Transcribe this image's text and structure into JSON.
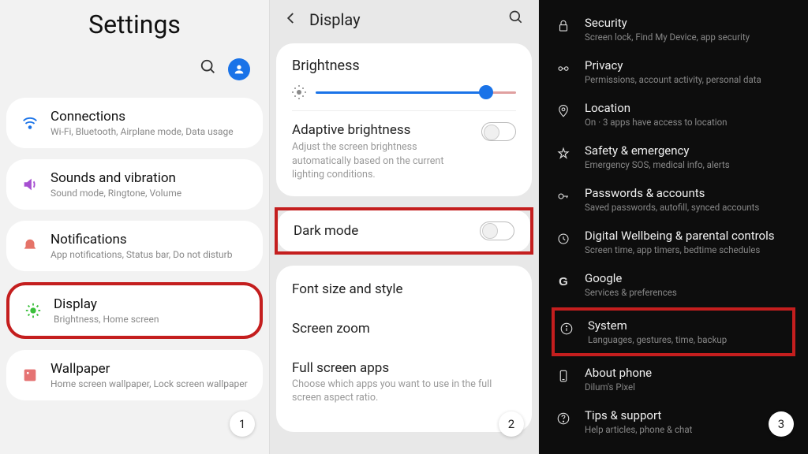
{
  "badges": {
    "one": "1",
    "two": "2",
    "three": "3"
  },
  "screen1": {
    "title": "Settings",
    "items": [
      {
        "icon": "wifi",
        "color": "#1a73e8",
        "title": "Connections",
        "desc": "Wi-Fi, Bluetooth, Airplane mode, Data usage"
      },
      {
        "icon": "sound",
        "color": "#a64fd1",
        "title": "Sounds and vibration",
        "desc": "Sound mode, Ringtone, Volume"
      },
      {
        "icon": "bell",
        "color": "#e57368",
        "title": "Notifications",
        "desc": "App notifications, Status bar, Do not disturb"
      },
      {
        "icon": "brightness",
        "color": "#3bbf3b",
        "title": "Display",
        "desc": "Brightness, Home screen",
        "highlight": true
      },
      {
        "icon": "wallpaper",
        "color": "#e57373",
        "title": "Wallpaper",
        "desc": "Home screen wallpaper, Lock screen wallpaper"
      }
    ]
  },
  "screen2": {
    "title": "Display",
    "brightness_header": "Brightness",
    "adaptive": {
      "title": "Adaptive brightness",
      "desc": "Adjust the screen brightness automatically based on the current lighting conditions."
    },
    "darkmode": "Dark mode",
    "list": [
      {
        "title": "Font size and style",
        "desc": ""
      },
      {
        "title": "Screen zoom",
        "desc": ""
      },
      {
        "title": "Full screen apps",
        "desc": "Choose which apps you want to use in the full screen aspect ratio."
      }
    ]
  },
  "screen3": {
    "items": [
      {
        "icon": "lock",
        "title": "Security",
        "desc": "Screen lock, Find My Device, app security"
      },
      {
        "icon": "privacy",
        "title": "Privacy",
        "desc": "Permissions, account activity, personal data"
      },
      {
        "icon": "pin",
        "title": "Location",
        "desc": "On · 3 apps have access to location"
      },
      {
        "icon": "star",
        "title": "Safety & emergency",
        "desc": "Emergency SOS, medical info, alerts"
      },
      {
        "icon": "key",
        "title": "Passwords & accounts",
        "desc": "Saved passwords, autofill, synced accounts"
      },
      {
        "icon": "wellbeing",
        "title": "Digital Wellbeing & parental controls",
        "desc": "Screen time, app timers, bedtime schedules"
      },
      {
        "icon": "google",
        "title": "Google",
        "desc": "Services & preferences"
      },
      {
        "icon": "info",
        "title": "System",
        "desc": "Languages, gestures, time, backup",
        "highlight": true
      },
      {
        "icon": "phone",
        "title": "About phone",
        "desc": "Dilum's Pixel"
      },
      {
        "icon": "help",
        "title": "Tips & support",
        "desc": "Help articles, phone & chat"
      }
    ]
  }
}
